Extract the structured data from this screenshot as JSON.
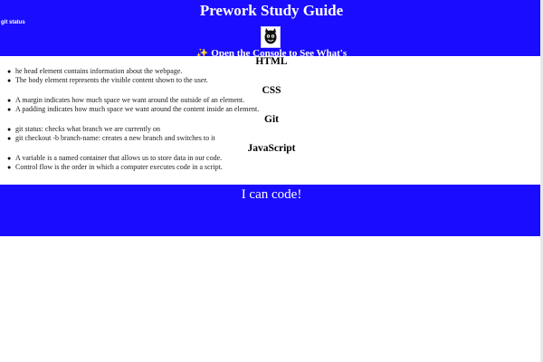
{
  "header": {
    "title": "Prework Study Guide",
    "note": "git status",
    "logo_icon": "mascot-face-icon",
    "console_message": "Open the Console to See What's Happening"
  },
  "sections": [
    {
      "title": "HTML",
      "items": [
        "he head element contains information about the webpage.",
        "The body element represents the visible content shown to the user."
      ]
    },
    {
      "title": "CSS",
      "items": [
        "A margin indicates how much space we want around the outside of an element.",
        "A padding indicates how much space we want around the content inside an element."
      ]
    },
    {
      "title": "Git",
      "items": [
        "git status: checks what branch we are currently on",
        "git checkout -b branch-name: creates a new branch and switches to it"
      ]
    },
    {
      "title": "JavaScript",
      "items": [
        "A variable is a named container that allows us to store data in our code.",
        "Control flow is the order in which a computer executes code in a script."
      ]
    }
  ],
  "footer": {
    "text": "I can code!"
  },
  "colors": {
    "band_blue": "#1a0dff",
    "accent_orange": "#ff9d2e"
  }
}
